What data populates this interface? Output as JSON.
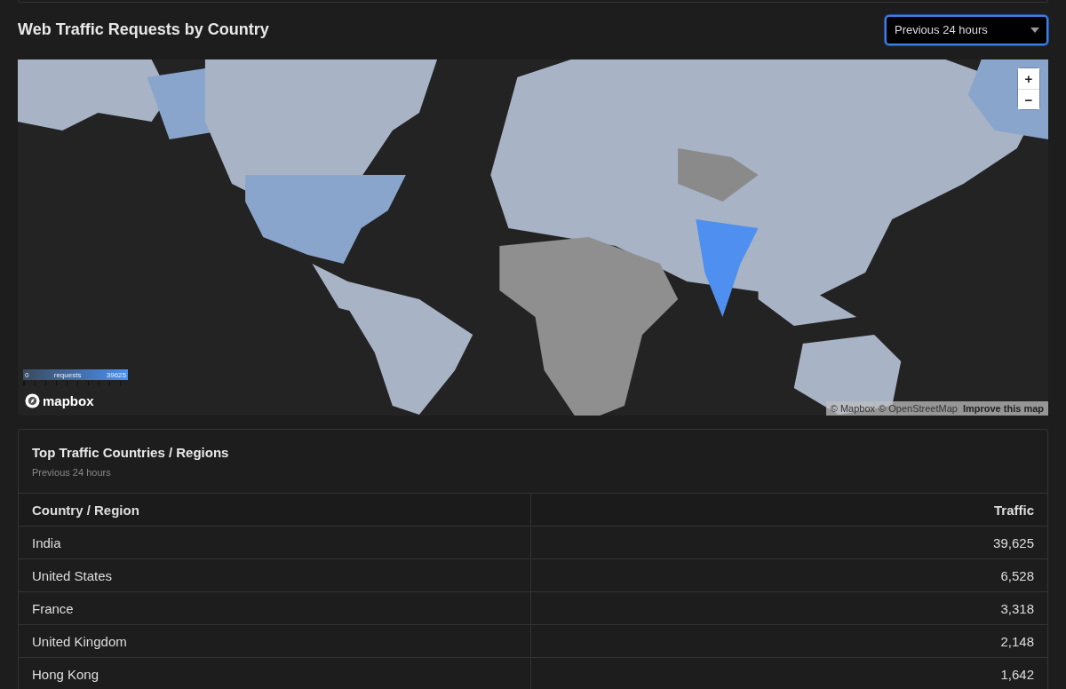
{
  "header": {
    "title": "Web Traffic Requests by Country",
    "range": {
      "value": "Previous 24 hours"
    }
  },
  "map": {
    "zoom_controls": [
      "+",
      "−"
    ],
    "legend": {
      "min": "0",
      "label": "requests",
      "max": "39625"
    },
    "logo": "mapbox",
    "attribution": [
      {
        "text": "© Mapbox",
        "strong": false
      },
      {
        "text": "© OpenStreetMap",
        "strong": false
      },
      {
        "text": "Improve this map",
        "strong": true
      }
    ]
  },
  "table_card": {
    "title": "Top Traffic Countries / Regions",
    "subtitle": "Previous 24 hours",
    "columns": [
      "Country / Region",
      "Traffic"
    ],
    "rows": [
      {
        "country": "India",
        "traffic": "39,625"
      },
      {
        "country": "United States",
        "traffic": "6,528"
      },
      {
        "country": "France",
        "traffic": "3,318"
      },
      {
        "country": "United Kingdom",
        "traffic": "2,148"
      },
      {
        "country": "Hong Kong",
        "traffic": "1,642"
      }
    ]
  }
}
